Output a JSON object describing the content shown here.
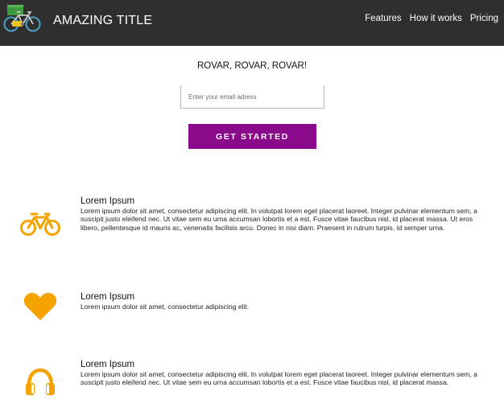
{
  "header": {
    "brand": "AMAZING TITLE",
    "logo_icon": "bicycle-logo-icon",
    "nav": [
      {
        "label": "Features"
      },
      {
        "label": "How it works"
      },
      {
        "label": "Pricing"
      }
    ]
  },
  "hero": {
    "tagline": "ROVAR, ROVAR, ROVAR!",
    "email_placeholder": "Enter your email adress",
    "cta_label": "GET STARTED"
  },
  "features": [
    {
      "icon": "bicycle-icon",
      "title": "Lorem Ipsum",
      "body": "Lorem ipsum dolor sit amet, consectetur adipiscing elit. In volutpat lorem eget placerat laoreet. Integer pulvinar elementum sem, a suscipit justo eleifend nec. Ut vitae sem eu urna accumsan lobortis et a est. Fusce vitae faucibus nisl, id placerat massa. Ut eros libero, pellentesque id mauris ac, venenatis facilisis arcu. Donec in nisi diam. Praesent in rutrum turpis, id semper urna."
    },
    {
      "icon": "heart-icon",
      "title": "Lorem Ipsum",
      "body": "Lorem ipsum dolor sit amet, consectetur adipiscing elit."
    },
    {
      "icon": "headphones-icon",
      "title": "Lorem Ipsum",
      "body": "Lorem ipsum dolor sit amet, consectetur adipiscing elit. In volutpat lorem eget placerat laoreet. Integer pulvinar elementum sem, a suscipit justo eleifend nec. Ut vitae sem eu urna accumsan lobortis et a est. Fusce vitae faucibus nisl, id placerat massa."
    }
  ],
  "colors": {
    "header_bg": "#2f2f2f",
    "accent_purple": "#8b0a8b",
    "icon_orange": "#f5a300"
  }
}
